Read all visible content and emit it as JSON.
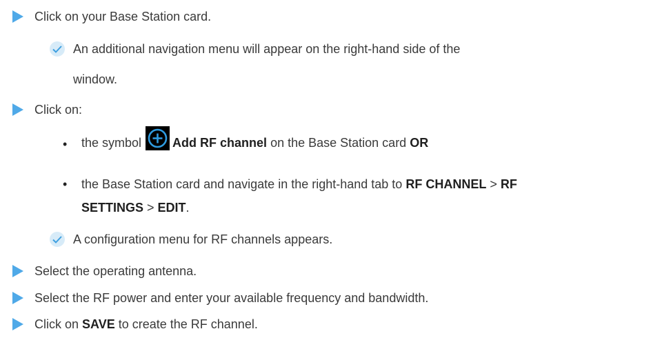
{
  "steps": {
    "s1": "Click on your Base Station card.",
    "r1a": "An additional navigation menu will appear on the right-hand side of the",
    "r1b": "window.",
    "s2": "Click on:",
    "b1_pre": "the symbol",
    "b1_bold1": "Add RF channel",
    "b1_mid": "on the Base Station card",
    "b1_bold2": "OR",
    "b2_pre": "the Base Station card and navigate in the right-hand tab to",
    "b2_bold1": "RF CHANNEL",
    "b2_sep1": ">",
    "b2_bold2": "RF",
    "b2_bold3": "SETTINGS",
    "b2_sep2": ">",
    "b2_bold4": "EDIT",
    "b2_end": ".",
    "r2": "A configuration menu for RF channels appears.",
    "s3": "Select the operating antenna.",
    "s4": "Select the RF power and enter your available frequency and bandwidth.",
    "s5_pre": "Click on",
    "s5_bold": "SAVE",
    "s5_post": "to create the RF channel."
  },
  "icons": {
    "step": "play-triangle-icon",
    "result": "checkmark-icon",
    "add": "add-circle-icon"
  },
  "colors": {
    "accent": "#4fa9e8",
    "check_bg": "#d7ebf8",
    "plus_ring": "#2f9be0"
  }
}
